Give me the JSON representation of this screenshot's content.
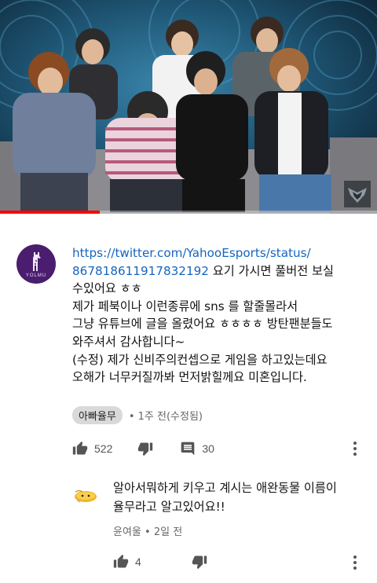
{
  "video": {
    "progress": 0.265
  },
  "comment": {
    "avatar_brand": "YOLMU",
    "link_line1": "https://twitter.com/YahooEsports/status/",
    "link_line2": "867818611917832192",
    "line2_rest": " 요기 가시면 풀버전 보실",
    "line3": "수있어요 ㅎㅎ",
    "line4": "제가 페북이나 이런종류에 sns 를 할줄몰라서",
    "line5": "그냥 유튜브에 글을 올렸어요 ㅎㅎㅎㅎ 방탄팬분들도",
    "line6": "와주셔서 감사합니다~",
    "line7": "(수정) 제가 신비주의컨셉으로 게임을 하고있는데요",
    "line8": "오해가 너무커질까봐 먼저밝힐께요 미혼입니다.",
    "author": "아빠율무",
    "time": "• 1주 전(수정됨)",
    "likes": "522",
    "replies": "30"
  },
  "reply": {
    "line1": "알아서뭐하게 키우고 계시는 애완동물 이름이",
    "line2": "율무라고 알고있어요!!",
    "author": "윤여울",
    "time": "• 2일 전",
    "likes": "4"
  },
  "colors": {
    "link": "#1565c0",
    "progress": "#ff0000",
    "avatar_bg": "#4b1d6e"
  }
}
